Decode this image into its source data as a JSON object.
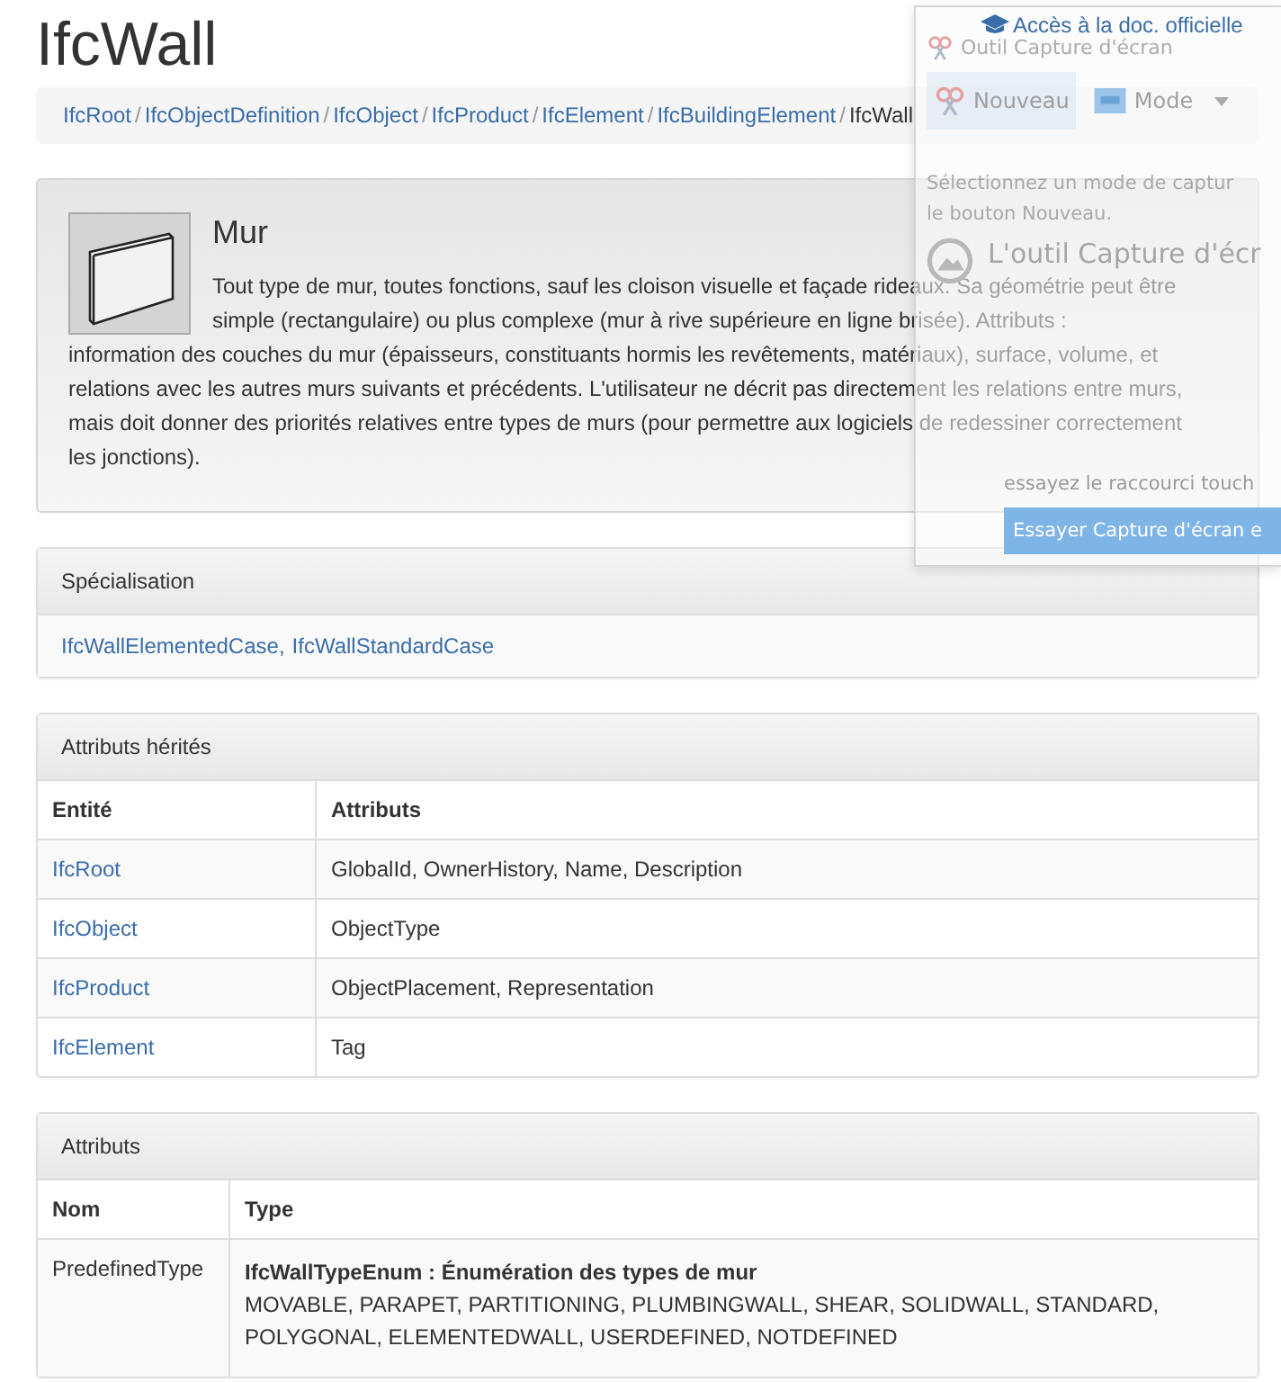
{
  "page": {
    "title": "IfcWall",
    "doc_link": "Accès à la doc. officielle"
  },
  "breadcrumb": {
    "separator": "/",
    "items": [
      {
        "label": "IfcRoot",
        "kind": "link"
      },
      {
        "label": "IfcObjectDefinition",
        "kind": "link"
      },
      {
        "label": "IfcObject",
        "kind": "link"
      },
      {
        "label": "IfcProduct",
        "kind": "link"
      },
      {
        "label": "IfcElement",
        "kind": "link"
      },
      {
        "label": "IfcBuildingElement",
        "kind": "link"
      },
      {
        "label": "IfcWall",
        "kind": "current"
      }
    ]
  },
  "summary": {
    "heading": "Mur",
    "description_beside": "Tout type de mur, toutes fonctions, sauf les cloison visuelle et façade rideaux. Sa géométrie peut être simple (rectangulaire) ou plus complexe (mur à rive supérieure en ligne brisée). Attributs :",
    "description_below": "information des couches du mur (épaisseurs, constituants hormis les revêtements, matériaux), surface, volume, et relations avec les autres murs suivants et précédents. L'utilisateur ne décrit pas directement les relations entre murs, mais doit donner des priorités relatives entre types de murs (pour permettre aux logiciels de redessiner correctement les jonctions)."
  },
  "specialisation": {
    "heading": "Spécialisation",
    "links": [
      "IfcWallElementedCase,",
      "IfcWallStandardCase"
    ]
  },
  "inherited_attributes": {
    "heading": "Attributs hérités",
    "columns": [
      "Entité",
      "Attributs"
    ],
    "rows": [
      {
        "entity": "IfcRoot",
        "attributes": "GlobalId, OwnerHistory, Name, Description"
      },
      {
        "entity": "IfcObject",
        "attributes": "ObjectType"
      },
      {
        "entity": "IfcProduct",
        "attributes": "ObjectPlacement, Representation"
      },
      {
        "entity": "IfcElement",
        "attributes": "Tag"
      }
    ]
  },
  "attributes": {
    "heading": "Attributs",
    "columns": [
      "Nom",
      "Type"
    ],
    "rows": [
      {
        "name": "PredefinedType",
        "type_title": "IfcWallTypeEnum : Énumération des types de mur",
        "values": "MOVABLE, PARAPET, PARTITIONING, PLUMBINGWALL, SHEAR, SOLIDWALL, STANDARD, POLYGONAL, ELEMENTEDWALL, USERDEFINED, NOTDEFINED"
      }
    ]
  },
  "snipping_overlay": {
    "title": "Outil Capture d'écran",
    "buttons": [
      {
        "label": "Nouveau",
        "kind": "new"
      },
      {
        "label": "Mode",
        "kind": "mode"
      }
    ],
    "hint_lines": [
      "Sélectionnez un mode de captur",
      "le bouton Nouveau."
    ],
    "promo_heading": "L'outil Capture d'écr",
    "promo_text": "essayez le raccourci touch",
    "promo_button": "Essayer Capture d'écran e"
  }
}
